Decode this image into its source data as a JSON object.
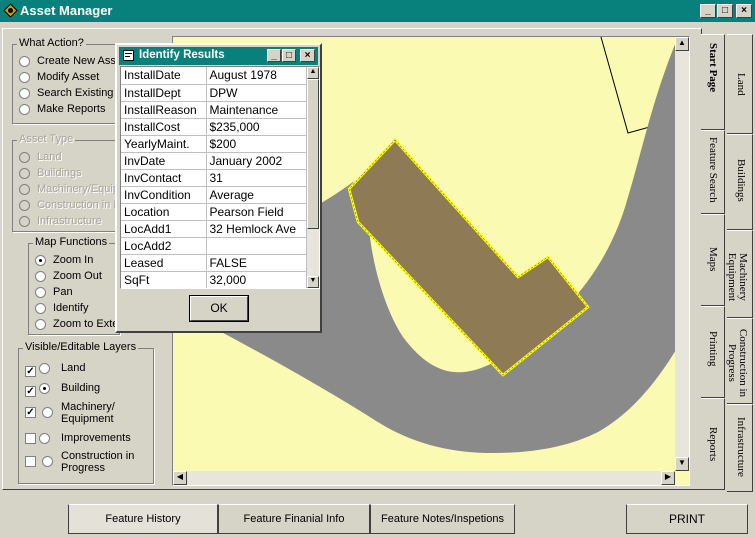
{
  "window": {
    "title": "Asset Manager"
  },
  "what_action": {
    "label": "What Action?",
    "options": [
      "Create New Asse",
      "Modify Asset",
      "Search Existing A",
      "Make Reports"
    ]
  },
  "asset_type": {
    "label": "Asset Type",
    "options": [
      "Land",
      "Buildings",
      "Machinery/Equip",
      "Construction in P",
      "Infrastructure"
    ]
  },
  "map_functions": {
    "label": "Map Functions",
    "options": [
      "Zoom In",
      "Zoom Out",
      "Pan",
      "Identify",
      "Zoom to Exte"
    ],
    "selected": "Zoom In"
  },
  "layers": {
    "label": "Visible/Editable Layers",
    "items": [
      {
        "label": "Land",
        "visible": true,
        "editable": false
      },
      {
        "label": "Building",
        "visible": true,
        "editable": true
      },
      {
        "label": "Machinery/ Equipment",
        "visible": true,
        "editable": false
      },
      {
        "label": "Improvements",
        "visible": false,
        "editable": false
      },
      {
        "label": "Construction in Progress",
        "visible": false,
        "editable": false
      }
    ]
  },
  "identify_dialog": {
    "title": "Identify Results",
    "ok_label": "OK",
    "rows": [
      [
        "InstallDate",
        "August 1978"
      ],
      [
        "InstallDept",
        "DPW"
      ],
      [
        "InstallReason",
        "Maintenance"
      ],
      [
        "InstallCost",
        "$235,000"
      ],
      [
        "YearlyMaint.",
        "$200"
      ],
      [
        "InvDate",
        "January 2002"
      ],
      [
        "InvContact",
        "31"
      ],
      [
        "InvCondition",
        "Average"
      ],
      [
        "Location",
        "Pearson Field"
      ],
      [
        "LocAdd1",
        "32 Hemlock Ave"
      ],
      [
        "LocAdd2",
        ""
      ],
      [
        "Leased",
        "FALSE"
      ],
      [
        "SqFt",
        "32,000"
      ]
    ]
  },
  "side_tabs": {
    "inner": [
      "Start Page",
      "Feature Search",
      "Maps",
      "Printing",
      "Reports"
    ],
    "outer": [
      "Land",
      "Buildings",
      "Machinery Equipment",
      "Construction in Progress",
      "Infrastructure"
    ]
  },
  "bottom_tabs": [
    "Feature History",
    "Feature Finanial Info",
    "Feature Notes/Inspetions"
  ],
  "print_label": "PRINT",
  "colors": {
    "title": "#08807b",
    "map_bg": "#fafab3",
    "road": "#8a8a8a",
    "building": "#8e7a55",
    "highlight": "#ffff00"
  }
}
